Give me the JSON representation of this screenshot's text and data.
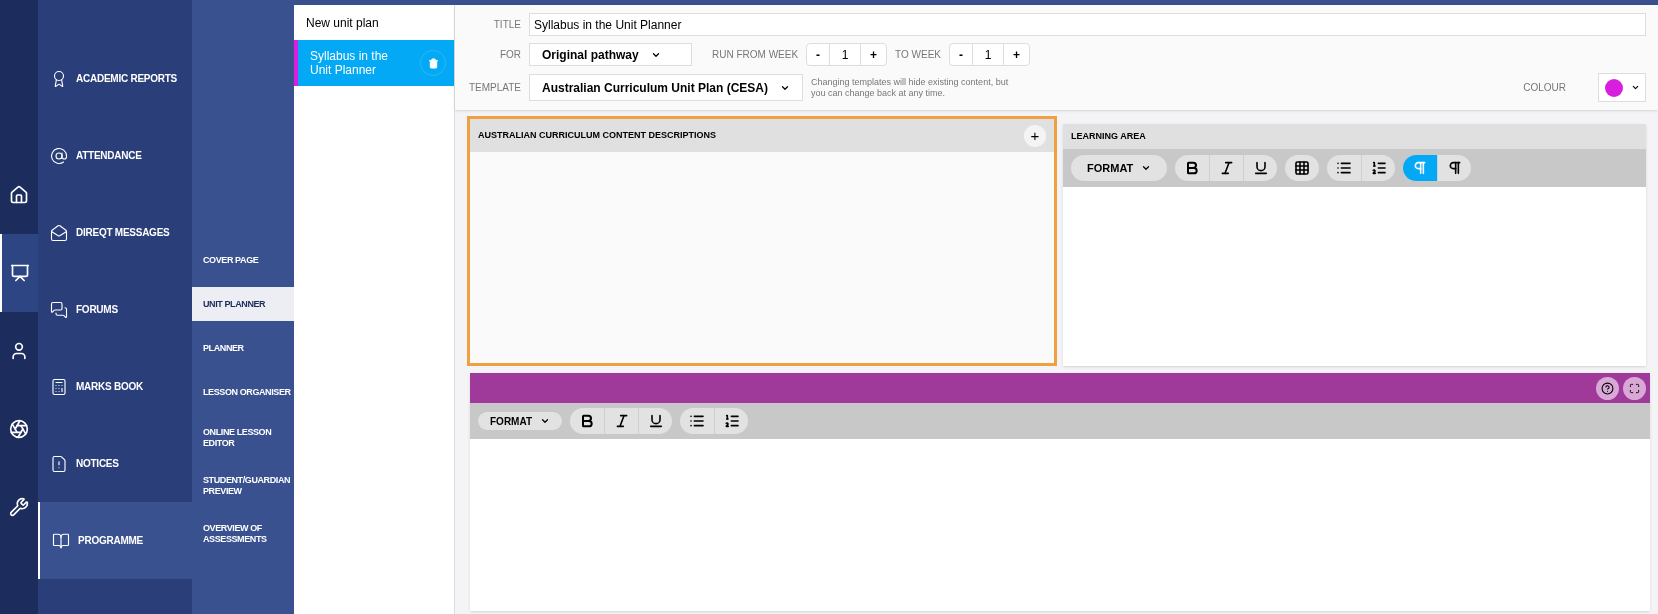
{
  "rail": [
    {
      "kind": "home",
      "selected": false
    },
    {
      "kind": "presentation",
      "selected": true
    },
    {
      "kind": "user",
      "selected": false
    },
    {
      "kind": "aperture",
      "selected": false
    },
    {
      "kind": "wrench",
      "selected": false
    }
  ],
  "menu": [
    {
      "kind": "award",
      "label": "ACADEMIC REPORTS",
      "selected": false
    },
    {
      "kind": "at",
      "label": "ATTENDANCE",
      "selected": false
    },
    {
      "kind": "mail",
      "label": "DIREQT MESSAGES",
      "selected": false
    },
    {
      "kind": "chat",
      "label": "FORUMS",
      "selected": false
    },
    {
      "kind": "calc",
      "label": "MARKS BOOK",
      "selected": false
    },
    {
      "kind": "notice",
      "label": "NOTICES",
      "selected": false
    },
    {
      "kind": "book",
      "label": "PROGRAMME",
      "selected": true
    }
  ],
  "submenu": [
    {
      "label": "COVER PAGE",
      "selected": false
    },
    {
      "label": "UNIT PLANNER",
      "selected": true
    },
    {
      "label": "PLANNER",
      "selected": false
    },
    {
      "label": "LESSON ORGANISER",
      "selected": false
    },
    {
      "label": "ONLINE LESSON EDITOR",
      "selected": false
    },
    {
      "label": "STUDENT/GUARDIAN PREVIEW",
      "selected": false
    },
    {
      "label": "OVERVIEW OF ASSESSMENTS",
      "selected": false
    }
  ],
  "unit_plans": [
    {
      "label": "New unit plan",
      "selected": false
    },
    {
      "label": "Syllabus in the Unit Planner",
      "selected": true,
      "color": "#d81fe0"
    }
  ],
  "form": {
    "title": {
      "label": "TITLE",
      "value": "Syllabus in the Unit Planner"
    },
    "for": {
      "label": "FOR",
      "value": "Original pathway"
    },
    "run_from": {
      "label": "RUN FROM WEEK",
      "value": "1",
      "minus": "-",
      "plus": "+"
    },
    "to_week": {
      "label": "TO WEEK",
      "value": "1",
      "minus": "-",
      "plus": "+"
    },
    "template": {
      "label": "TEMPLATE",
      "value": "Australian Curriculum Unit Plan (CESA)",
      "hint": "Changing templates will hide existing content, but you can change back at any time."
    },
    "colour": {
      "label": "COLOUR",
      "color": "#d81fe0"
    }
  },
  "content_descriptions": {
    "title": "AUSTRALIAN CURRICULUM CONTENT DESCRIPTIONS",
    "add": "+"
  },
  "learning_area": {
    "title": "LEARNING AREA",
    "toolbar": {
      "format": "FORMAT",
      "groups": [
        [
          {
            "kind": "bold",
            "selected": false
          },
          {
            "kind": "italic",
            "selected": false
          },
          {
            "kind": "underline",
            "selected": false
          }
        ],
        [
          {
            "kind": "table",
            "selected": false
          }
        ],
        [
          {
            "kind": "bullets",
            "selected": false
          },
          {
            "kind": "numbered",
            "selected": false
          }
        ],
        [
          {
            "kind": "ltr",
            "selected": true
          },
          {
            "kind": "rtl",
            "selected": false
          }
        ]
      ]
    }
  },
  "editor": {
    "color": "#a03a9a",
    "toolbar": {
      "format": "FORMAT",
      "groups": [
        [
          {
            "kind": "bold",
            "selected": false
          },
          {
            "kind": "italic",
            "selected": false
          },
          {
            "kind": "underline",
            "selected": false
          }
        ],
        [
          {
            "kind": "bullets",
            "selected": false
          },
          {
            "kind": "numbered",
            "selected": false
          }
        ]
      ]
    }
  }
}
